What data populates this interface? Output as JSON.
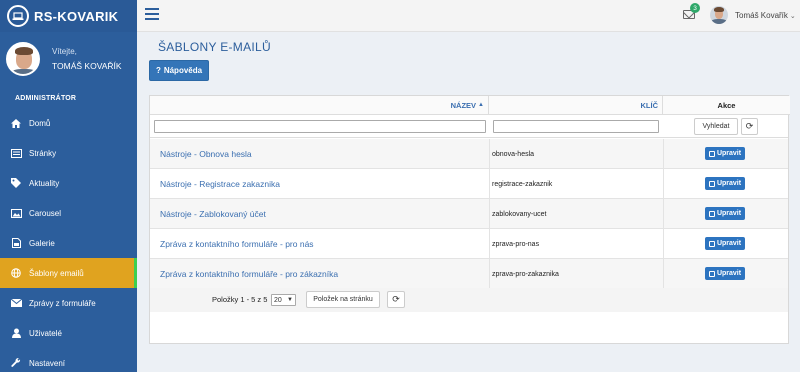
{
  "brand": {
    "title": "RS-KOVARIK"
  },
  "user_panel": {
    "welcome": "Vítejte,",
    "name": "TOMÁŠ KOVAŘÍK"
  },
  "sidebar": {
    "section": "ADMINISTRÁTOR",
    "items": [
      {
        "label": "Domů",
        "icon": "home-icon"
      },
      {
        "label": "Stránky",
        "icon": "pages-icon"
      },
      {
        "label": "Aktuality",
        "icon": "tag-icon"
      },
      {
        "label": "Carousel",
        "icon": "image-icon"
      },
      {
        "label": "Galerie",
        "icon": "file-icon"
      },
      {
        "label": "Šablony emailů",
        "icon": "globe-icon",
        "active": true
      },
      {
        "label": "Zprávy z formuláře",
        "icon": "envelope-icon"
      },
      {
        "label": "Uživatelé",
        "icon": "user-icon"
      },
      {
        "label": "Nastavení",
        "icon": "wrench-icon"
      }
    ],
    "active_color": "#e0a31f"
  },
  "topbar": {
    "notification_count": "3",
    "user_name": "Tomáš Kovařík",
    "caret": "⌄"
  },
  "page": {
    "title": "ŠABLONY E-MAILŮ",
    "help_label": "Nápověda"
  },
  "grid": {
    "columns": {
      "name": "NÁZEV",
      "key": "KLÍČ",
      "actions": "Akce"
    },
    "search_label": "Vyhledat",
    "edit_label": "Upravit",
    "rows": [
      {
        "name": "Nástroje - Obnova hesla",
        "key": "obnova-hesla"
      },
      {
        "name": "Nástroje - Registrace zakaznika",
        "key": "registrace-zakaznik"
      },
      {
        "name": "Nástroje - Zablokovaný účet",
        "key": "zablokovany-ucet"
      },
      {
        "name": "Zpráva z kontaktního formuláře - pro nás",
        "key": "zprava-pro-nas"
      },
      {
        "name": "Zpráva z kontaktního formuláře - pro zákazníka",
        "key": "zprava-pro-zakaznika"
      }
    ],
    "pager": {
      "summary": "Položky 1 - 5 z 5",
      "page_size": "20",
      "page_size_button": "Položek na stránku"
    }
  }
}
